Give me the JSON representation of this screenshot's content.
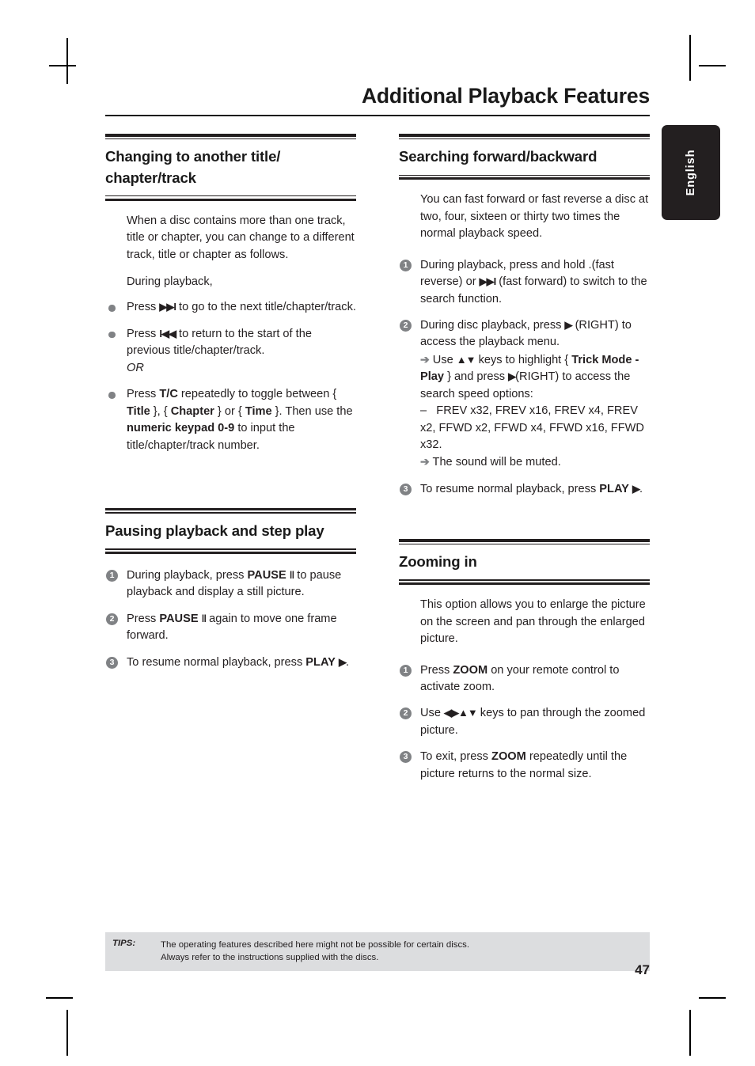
{
  "header": {
    "title": "Additional Playback Features",
    "language_tab": "English"
  },
  "left_column": {
    "section1": {
      "heading": "Changing to another title/ chapter/track",
      "intro": "When a disc contains more than one track, title or chapter, you can change to a different track, title or chapter as follows.",
      "subintro": "During playback,",
      "bullets": [
        {
          "text_before": "Press ",
          "glyph": "▶▶I",
          "text_after": " to go to the next title/chapter/track."
        },
        {
          "text_before": "Press ",
          "glyph": "I◀◀",
          "text_after": " to return to the start of the previous title/chapter/track.",
          "or_label": "OR"
        },
        {
          "segments_text": "Press T/C repeatedly to toggle between { Title }, { Chapter } or { Time }. Then use the numeric keypad 0-9 to input the title/chapter/track number."
        }
      ]
    },
    "section2": {
      "heading": "Pausing playback and step play",
      "steps": [
        {
          "number": "1",
          "text": "During playback, press PAUSE Ⅱ to pause playback and display a still picture."
        },
        {
          "number": "2",
          "text": "Press PAUSE Ⅱ again to move one frame forward."
        },
        {
          "number": "3",
          "text": "To resume normal playback, press PLAY ▶."
        }
      ]
    }
  },
  "right_column": {
    "section1": {
      "heading": "Searching forward/backward",
      "intro": "You can fast forward or fast reverse a disc at two, four, sixteen or thirty two times the normal playback speed.",
      "steps": [
        {
          "number": "1",
          "text": "During playback, press and hold .(fast reverse) or ▶▶I (fast forward) to switch to the search function."
        },
        {
          "number": "2",
          "text": "During disc playback, press ▶ (RIGHT) to access the playback menu.",
          "sub1": "Use ▲▼ keys to highlight { Trick Mode - Play } and press ▶(RIGHT) to access the search speed options:",
          "dash_item": "FREV x32, FREV x16, FREV x4, FREV x2, FFWD x2, FFWD x4, FFWD x16, FFWD x32.",
          "sub2": "The sound will be muted."
        },
        {
          "number": "3",
          "text": "To resume normal playback, press PLAY ▶."
        }
      ]
    },
    "section2": {
      "heading": "Zooming in",
      "intro": "This option allows you to enlarge the picture on the screen and pan through the enlarged picture.",
      "steps": [
        {
          "number": "1",
          "text": "Press ZOOM on your remote control to activate zoom."
        },
        {
          "number": "2",
          "text": "Use ◀▶▲▼ keys to pan through the zoomed picture."
        },
        {
          "number": "3",
          "text": "To exit, press ZOOM repeatedly until the picture returns to the normal size."
        }
      ]
    }
  },
  "footer": {
    "tips_label": "TIPS:",
    "tips_line1": "The operating features described here might not be possible for certain discs.",
    "tips_line2": "Always refer to the instructions supplied with the discs.",
    "page_number": "47"
  },
  "colors": {
    "text": "#231f20",
    "bullet_gray": "#808285",
    "tips_bg": "#dcdddf",
    "tab_bg": "#231f20"
  }
}
